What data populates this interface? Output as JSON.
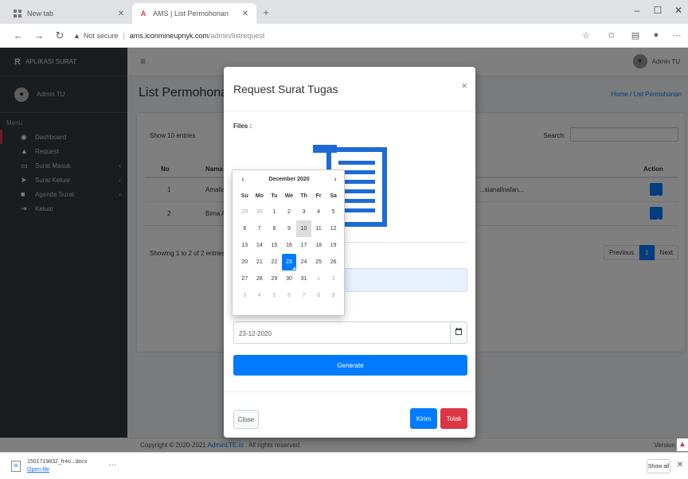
{
  "browser": {
    "tabs": [
      {
        "label": "New tab",
        "favicon": "grid-icon",
        "active": false
      },
      {
        "label": "AMS | List Permohonan",
        "favicon": "a-icon",
        "active": true
      }
    ],
    "new_tab_symbol": "+",
    "window_controls": [
      "–",
      "☐",
      "✕"
    ],
    "address": {
      "security": "Not secure",
      "host": "ams.iconmineupnyk.com",
      "path": "/admin/listrequest"
    }
  },
  "app": {
    "brand": {
      "logo": "R",
      "name": "APLIKASI SURAT"
    },
    "user_name": "Admin TU",
    "menu_header": "Menu",
    "menu": [
      {
        "label": "Dashboard",
        "icon": "gauge-icon",
        "has_children": false,
        "active": true
      },
      {
        "label": "Request",
        "icon": "bell-icon",
        "has_children": false,
        "active": false
      },
      {
        "label": "Surat Masuk",
        "icon": "inbox-icon",
        "has_children": true,
        "active": false
      },
      {
        "label": "Surat Keluar",
        "icon": "send-icon",
        "has_children": true,
        "active": false
      },
      {
        "label": "Agenda Surat",
        "icon": "book-icon",
        "has_children": true,
        "active": false
      },
      {
        "label": "Keluar",
        "icon": "logout-icon",
        "has_children": false,
        "active": false
      }
    ],
    "top_user": "Admin TU",
    "page_title": "List Permohonan",
    "breadcrumb": "Home / List Permohonan",
    "table": {
      "show_entries": "Show 10 entries",
      "search_label": "Search:",
      "headers": [
        "No",
        "Nama",
        "Action"
      ],
      "rows": [
        {
          "no": "1",
          "name": "Amalia",
          "desc": "...sianallnafan..."
        },
        {
          "no": "2",
          "name": "Bima Ar"
        }
      ],
      "showing": "Showing 1 to 2 of 2 entries",
      "pager": {
        "prev": "Previous",
        "current": "1",
        "next": "Next"
      }
    },
    "footer": {
      "text": "Copyright © 2020-2021",
      "link": "AdminLTE.io",
      "suffix": ". All rights reserved.",
      "version": "Version"
    }
  },
  "modal": {
    "title": "Request Surat Tugas",
    "close_symbol": "×",
    "files_label": "Files :",
    "field_label_1": "",
    "field_label_2": "",
    "date_value": "23-12-2020",
    "calendar_icon": "calendar-icon",
    "generate_label": "Generate",
    "close_label": "Close",
    "kirim_label": "Kirim",
    "tolak_label": "Tolak",
    "file_icon_color": "#1e6bd6"
  },
  "datepicker": {
    "prev": "‹",
    "next": "›",
    "month_label": "December 2020",
    "dows": [
      "Su",
      "Mo",
      "Tu",
      "We",
      "Th",
      "Fr",
      "Sa"
    ],
    "weeks": [
      [
        {
          "d": "29",
          "old": true
        },
        {
          "d": "30",
          "old": true
        },
        {
          "d": "1"
        },
        {
          "d": "2"
        },
        {
          "d": "3"
        },
        {
          "d": "4"
        },
        {
          "d": "5"
        }
      ],
      [
        {
          "d": "6"
        },
        {
          "d": "7"
        },
        {
          "d": "8"
        },
        {
          "d": "9"
        },
        {
          "d": "10",
          "today": true
        },
        {
          "d": "11"
        },
        {
          "d": "12"
        }
      ],
      [
        {
          "d": "13"
        },
        {
          "d": "14"
        },
        {
          "d": "15"
        },
        {
          "d": "16"
        },
        {
          "d": "17"
        },
        {
          "d": "18"
        },
        {
          "d": "19"
        }
      ],
      [
        {
          "d": "20"
        },
        {
          "d": "21"
        },
        {
          "d": "22"
        },
        {
          "d": "23",
          "selected": true
        },
        {
          "d": "24"
        },
        {
          "d": "25"
        },
        {
          "d": "26"
        }
      ],
      [
        {
          "d": "27"
        },
        {
          "d": "28"
        },
        {
          "d": "29"
        },
        {
          "d": "30"
        },
        {
          "d": "31"
        },
        {
          "d": "1",
          "old": true
        },
        {
          "d": "2",
          "old": true
        }
      ],
      [
        {
          "d": "3",
          "old": true
        },
        {
          "d": "4",
          "old": true
        },
        {
          "d": "5",
          "old": true
        },
        {
          "d": "6",
          "old": true
        },
        {
          "d": "7",
          "old": true
        },
        {
          "d": "8",
          "old": true
        },
        {
          "d": "9",
          "old": true
        }
      ]
    ]
  },
  "download_bar": {
    "file_name": "1501719832_fr4o...docx",
    "open_label": "Open file",
    "more_symbol": "…",
    "show_all": "Show all",
    "close_symbol": "✕"
  }
}
